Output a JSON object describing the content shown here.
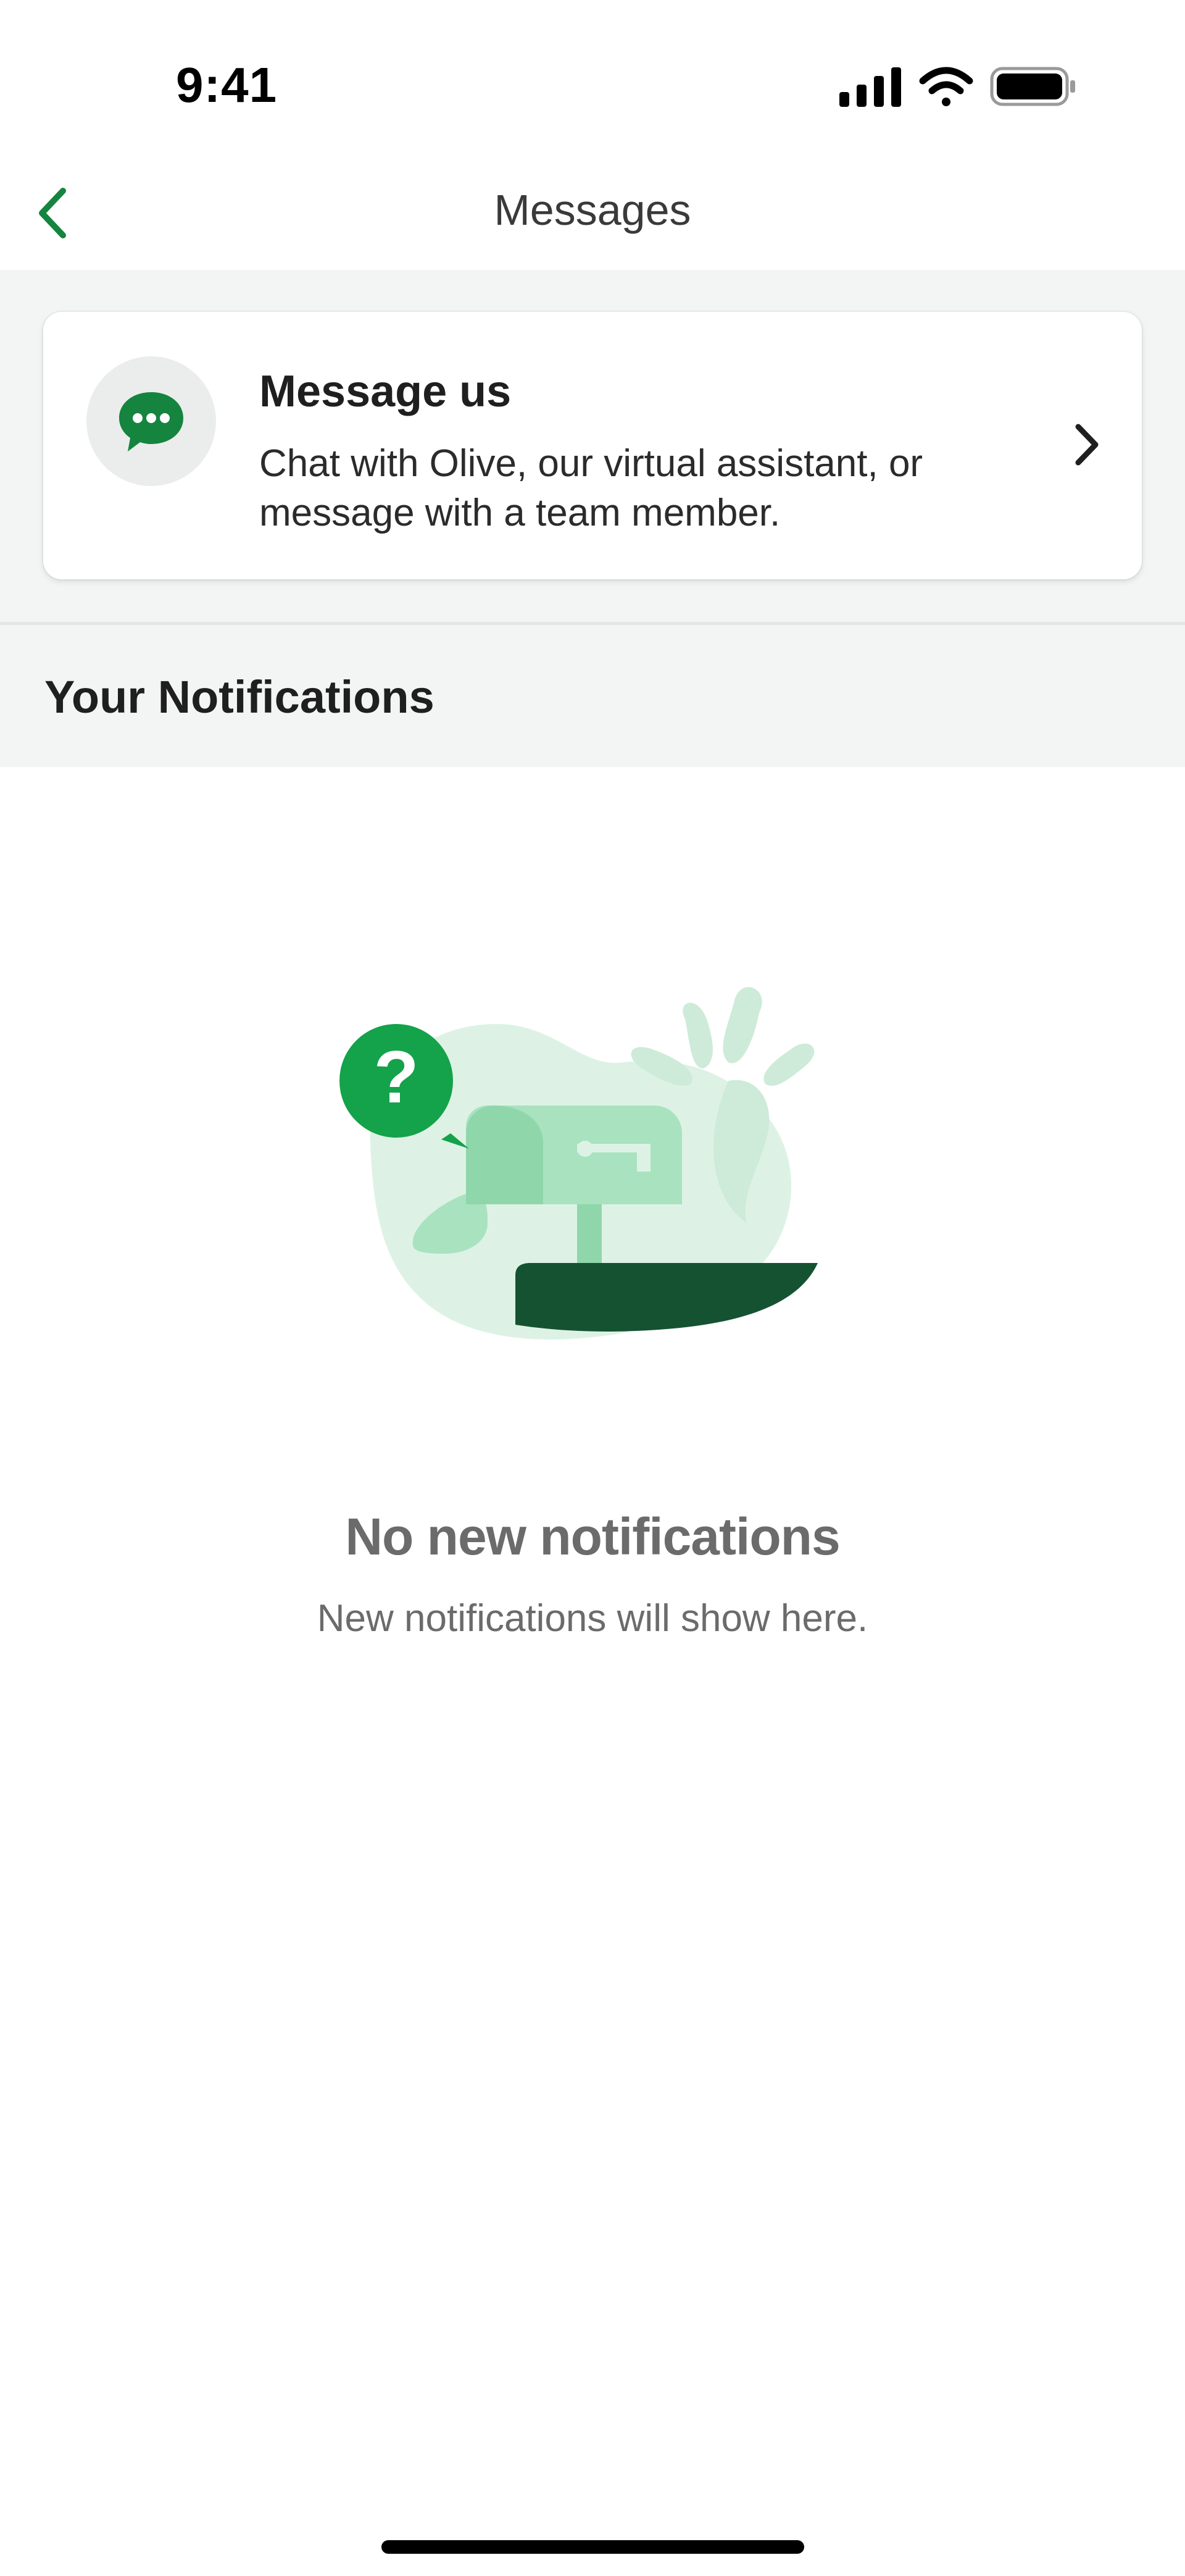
{
  "status_bar": {
    "time": "9:41",
    "icons": [
      "cellular-signal-icon",
      "wifi-icon",
      "battery-icon"
    ]
  },
  "header": {
    "title": "Messages",
    "back_icon": "chevron-left-icon"
  },
  "message_card": {
    "title": "Message us",
    "description": "Chat with Olive, our virtual assistant, or message with a team member.",
    "icon": "chat-bubble-icon",
    "chevron_icon": "chevron-right-icon"
  },
  "notifications": {
    "heading": "Your Notifications",
    "empty_title": "No new notifications",
    "empty_subtitle": "New notifications will show here.",
    "illustration": "mailbox-question-illustration"
  },
  "colors": {
    "accent_green": "#14a24a",
    "dark_green": "#155232",
    "light_green": "#8fd7aa",
    "pale_green": "#ddf2e5",
    "section_gray": "#f3f5f4"
  }
}
